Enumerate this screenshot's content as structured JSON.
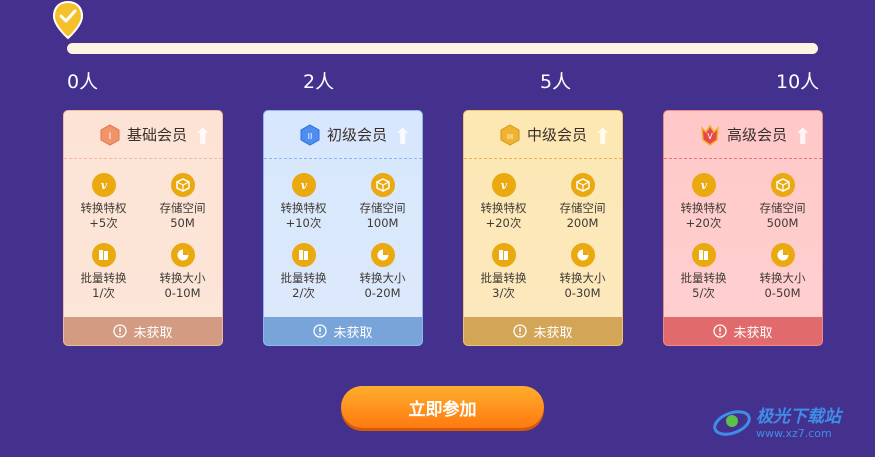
{
  "progress": {
    "ticks": [
      "0人",
      "2人",
      "5人",
      "10人"
    ],
    "current": 0
  },
  "tiers": [
    {
      "name": "基础会员",
      "badge": "I",
      "features": [
        {
          "icon": "v-icon",
          "title": "转换特权",
          "value": "+5次"
        },
        {
          "icon": "storage-box-icon",
          "title": "存储空间",
          "value": "50M"
        },
        {
          "icon": "batch-file-icon",
          "title": "批量转换",
          "value": "1/次"
        },
        {
          "icon": "pie-size-icon",
          "title": "转换大小",
          "value": "0-10M"
        }
      ],
      "status": "未获取"
    },
    {
      "name": "初级会员",
      "badge": "II",
      "features": [
        {
          "icon": "v-icon",
          "title": "转换特权",
          "value": "+10次"
        },
        {
          "icon": "storage-box-icon",
          "title": "存储空间",
          "value": "100M"
        },
        {
          "icon": "batch-file-icon",
          "title": "批量转换",
          "value": "2/次"
        },
        {
          "icon": "pie-size-icon",
          "title": "转换大小",
          "value": "0-20M"
        }
      ],
      "status": "未获取"
    },
    {
      "name": "中级会员",
      "badge": "III",
      "features": [
        {
          "icon": "v-icon",
          "title": "转换特权",
          "value": "+20次"
        },
        {
          "icon": "storage-box-icon",
          "title": "存储空间",
          "value": "200M"
        },
        {
          "icon": "batch-file-icon",
          "title": "批量转换",
          "value": "3/次"
        },
        {
          "icon": "pie-size-icon",
          "title": "转换大小",
          "value": "0-30M"
        }
      ],
      "status": "未获取"
    },
    {
      "name": "高级会员",
      "badge": "V",
      "features": [
        {
          "icon": "v-icon",
          "title": "转换特权",
          "value": "+20次"
        },
        {
          "icon": "storage-box-icon",
          "title": "存储空间",
          "value": "500M"
        },
        {
          "icon": "batch-file-icon",
          "title": "批量转换",
          "value": "5/次"
        },
        {
          "icon": "pie-size-icon",
          "title": "转换大小",
          "value": "0-50M"
        }
      ],
      "status": "未获取"
    }
  ],
  "join_button": "立即参加",
  "watermark": {
    "title": "极光下载站",
    "url": "www.xz7.com"
  },
  "colors": {
    "background": "#44308d",
    "accent": "#ff8a1a",
    "icon": "#e9a90f"
  }
}
